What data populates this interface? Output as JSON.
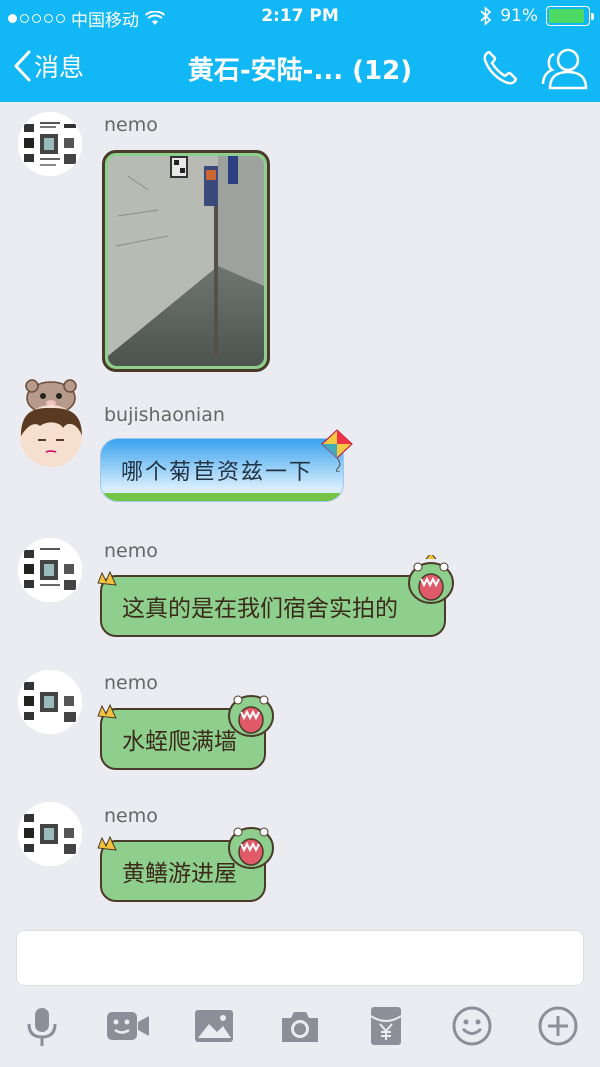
{
  "status_bar": {
    "carrier": "中国移动",
    "time": "2:17 PM",
    "battery_percent": "91%",
    "battery_level": 0.91,
    "signal_dots_filled": 1,
    "signal_dots_total": 5
  },
  "navbar": {
    "back_label": "消息",
    "title": "黄石-安陆-... (12)"
  },
  "messages": [
    {
      "sender": "nemo",
      "type": "image",
      "text": ""
    },
    {
      "sender": "bujishaonian",
      "type": "text",
      "text": "哪个菊苣资兹一下"
    },
    {
      "sender": "nemo",
      "type": "text",
      "text": "这真的是在我们宿舍实拍的"
    },
    {
      "sender": "nemo",
      "type": "text",
      "text": "水蛭爬满墙"
    },
    {
      "sender": "nemo",
      "type": "text",
      "text": "黄鳝游进屋"
    }
  ],
  "input": {
    "placeholder": ""
  },
  "toolbar": {
    "icons": [
      "microphone-icon",
      "video-icon",
      "image-icon",
      "camera-icon",
      "red-packet-icon",
      "emoji-icon",
      "plus-icon"
    ]
  },
  "colors": {
    "header": "#12b7f5",
    "background": "#ebecf1",
    "bubble_green": "#8fcf8d",
    "battery": "#4cd964",
    "icon_gray": "#8e8e99"
  }
}
